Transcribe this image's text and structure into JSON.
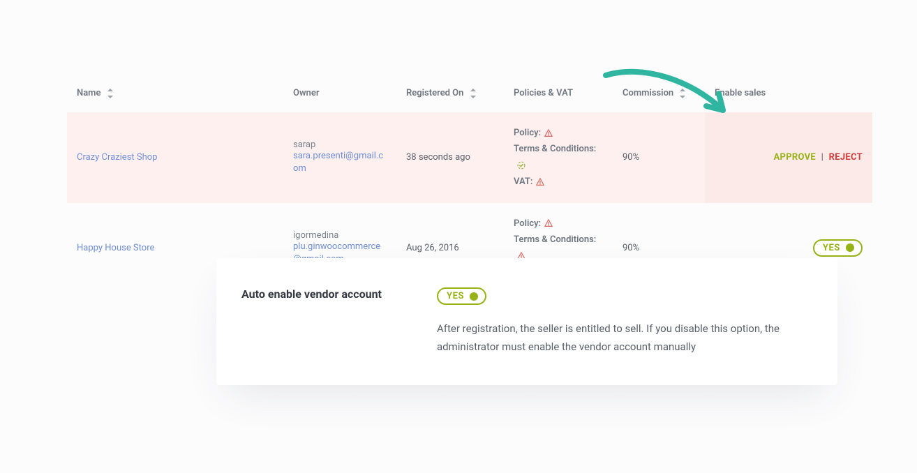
{
  "columns": {
    "name": "Name",
    "owner": "Owner",
    "registered": "Registered On",
    "policies": "Policies & VAT",
    "commission": "Commission",
    "enable": "Enable sales"
  },
  "labels": {
    "policy": "Policy:",
    "terms": "Terms & Conditions:",
    "vat": "VAT:",
    "approve": "APPROVE",
    "reject": "REJECT",
    "separator": "|",
    "yes": "YES"
  },
  "rows": [
    {
      "name": "Crazy Craziest Shop",
      "owner_user": "sarap",
      "owner_email": "sara.presenti@gmail.com",
      "registered": "38 seconds ago",
      "policy_state": "warn",
      "terms_state": "ok",
      "vat_state": "warn",
      "commission": "90%",
      "status": "pending"
    },
    {
      "name": "Happy House Store",
      "owner_user": "igormedina",
      "owner_email": "plu.ginwoocommerce@gmail.com",
      "registered": "Aug 26, 2016",
      "policy_state": "warn",
      "terms_state": "warn",
      "vat_state": "ok",
      "commission": "90%",
      "status": "enabled"
    }
  ],
  "card": {
    "title": "Auto enable vendor account",
    "toggle": "YES",
    "description": "After registration, the seller is entitled to sell. If you disable this option, the administrator must enable the vendor account manually"
  }
}
